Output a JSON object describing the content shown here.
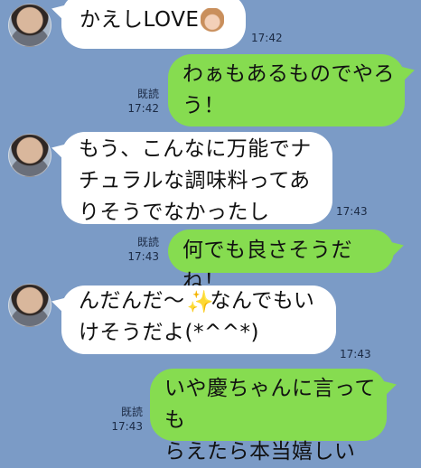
{
  "messages": [
    {
      "id": "m1",
      "side": "in",
      "line1": "かえしLOVE",
      "emoji": "girl-emoji",
      "time": "17:42"
    },
    {
      "id": "m2",
      "side": "out",
      "line1": "わぁもあるものでやろ",
      "line2": "う！",
      "read": "既読",
      "time": "17:42"
    },
    {
      "id": "m3",
      "side": "in",
      "line1": "もう、こんなに万能でナ",
      "line2": "チュラルな調味料ってあ",
      "line3": "りそうでなかったし",
      "time": "17:43"
    },
    {
      "id": "m4",
      "side": "out",
      "line1": "何でも良さそうだね！",
      "read": "既読",
      "time": "17:43"
    },
    {
      "id": "m5",
      "side": "in",
      "line1a": "んだんだ〜",
      "sparkle": "✨",
      "line1b": "なんでもい",
      "line2": "けそうだよ(*^^*)",
      "time": "17:43"
    },
    {
      "id": "m6",
      "side": "out",
      "line1": "いや慶ちゃんに言っても",
      "line2": "らえたら本当嬉しい",
      "read": "既読",
      "time": "17:43"
    }
  ],
  "colors": {
    "background": "#7b9bc6",
    "incoming": "#ffffff",
    "outgoing": "#86dc50"
  }
}
